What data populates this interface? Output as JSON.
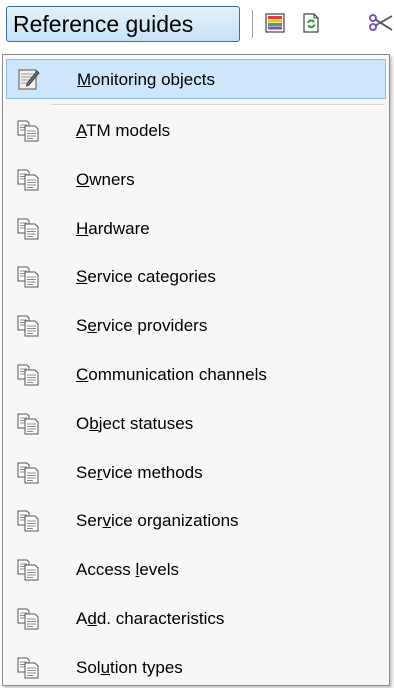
{
  "toolbar": {
    "reference_guides_label": "Reference guides",
    "icons": [
      "color-bars-icon",
      "refresh-document-icon",
      "scissors-icon"
    ]
  },
  "menu": {
    "items": [
      {
        "pre": "",
        "accel": "M",
        "post": "onitoring objects",
        "icon": "monitoring-object-icon",
        "selected": true
      },
      {
        "pre": "",
        "accel": "A",
        "post": "TM models",
        "icon": "documents-icon"
      },
      {
        "pre": "",
        "accel": "O",
        "post": "wners",
        "icon": "documents-icon"
      },
      {
        "pre": "",
        "accel": "H",
        "post": "ardware",
        "icon": "documents-icon"
      },
      {
        "pre": "",
        "accel": "S",
        "post": "ervice categories",
        "icon": "documents-icon"
      },
      {
        "pre": "S",
        "accel": "e",
        "post": "rvice providers",
        "icon": "documents-icon"
      },
      {
        "pre": "",
        "accel": "C",
        "post": "ommunication channels",
        "icon": "documents-icon"
      },
      {
        "pre": "O",
        "accel": "b",
        "post": "ject statuses",
        "icon": "documents-icon"
      },
      {
        "pre": "Se",
        "accel": "r",
        "post": "vice methods",
        "icon": "documents-icon"
      },
      {
        "pre": "Ser",
        "accel": "v",
        "post": "ice organizations",
        "icon": "documents-icon"
      },
      {
        "pre": "Access ",
        "accel": "l",
        "post": "evels",
        "icon": "documents-icon"
      },
      {
        "pre": "A",
        "accel": "d",
        "post": "d. characteristics",
        "icon": "documents-icon"
      },
      {
        "pre": "Sol",
        "accel": "u",
        "post": "tion types",
        "icon": "documents-icon"
      }
    ]
  }
}
